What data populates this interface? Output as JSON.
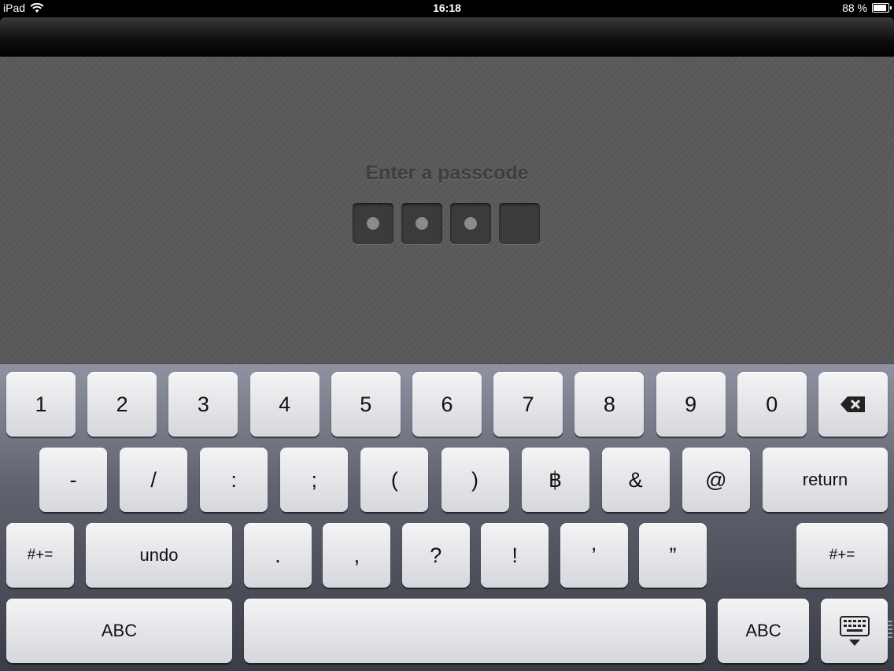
{
  "status_bar": {
    "device": "iPad",
    "time": "16:18",
    "battery_text": "88 %",
    "battery_level": 0.88
  },
  "passcode": {
    "title": "Enter a passcode",
    "total_digits": 4,
    "filled_digits": 3
  },
  "keyboard": {
    "row1": [
      "1",
      "2",
      "3",
      "4",
      "5",
      "6",
      "7",
      "8",
      "9",
      "0"
    ],
    "row2": [
      "-",
      "/",
      ":",
      ";",
      "(",
      ")",
      "฿",
      "&",
      "@"
    ],
    "return_label": "return",
    "row3_left_shift": "#+=",
    "undo_label": "undo",
    "row3": [
      ".",
      ",",
      "?",
      "!",
      "’",
      "”"
    ],
    "row3_right_shift": "#+=",
    "abc_left": "ABC",
    "abc_right": "ABC"
  },
  "icons": {
    "delete": "backspace-icon",
    "hide_keyboard": "keyboard-hide-icon",
    "wifi": "wifi-icon",
    "battery": "battery-icon"
  }
}
